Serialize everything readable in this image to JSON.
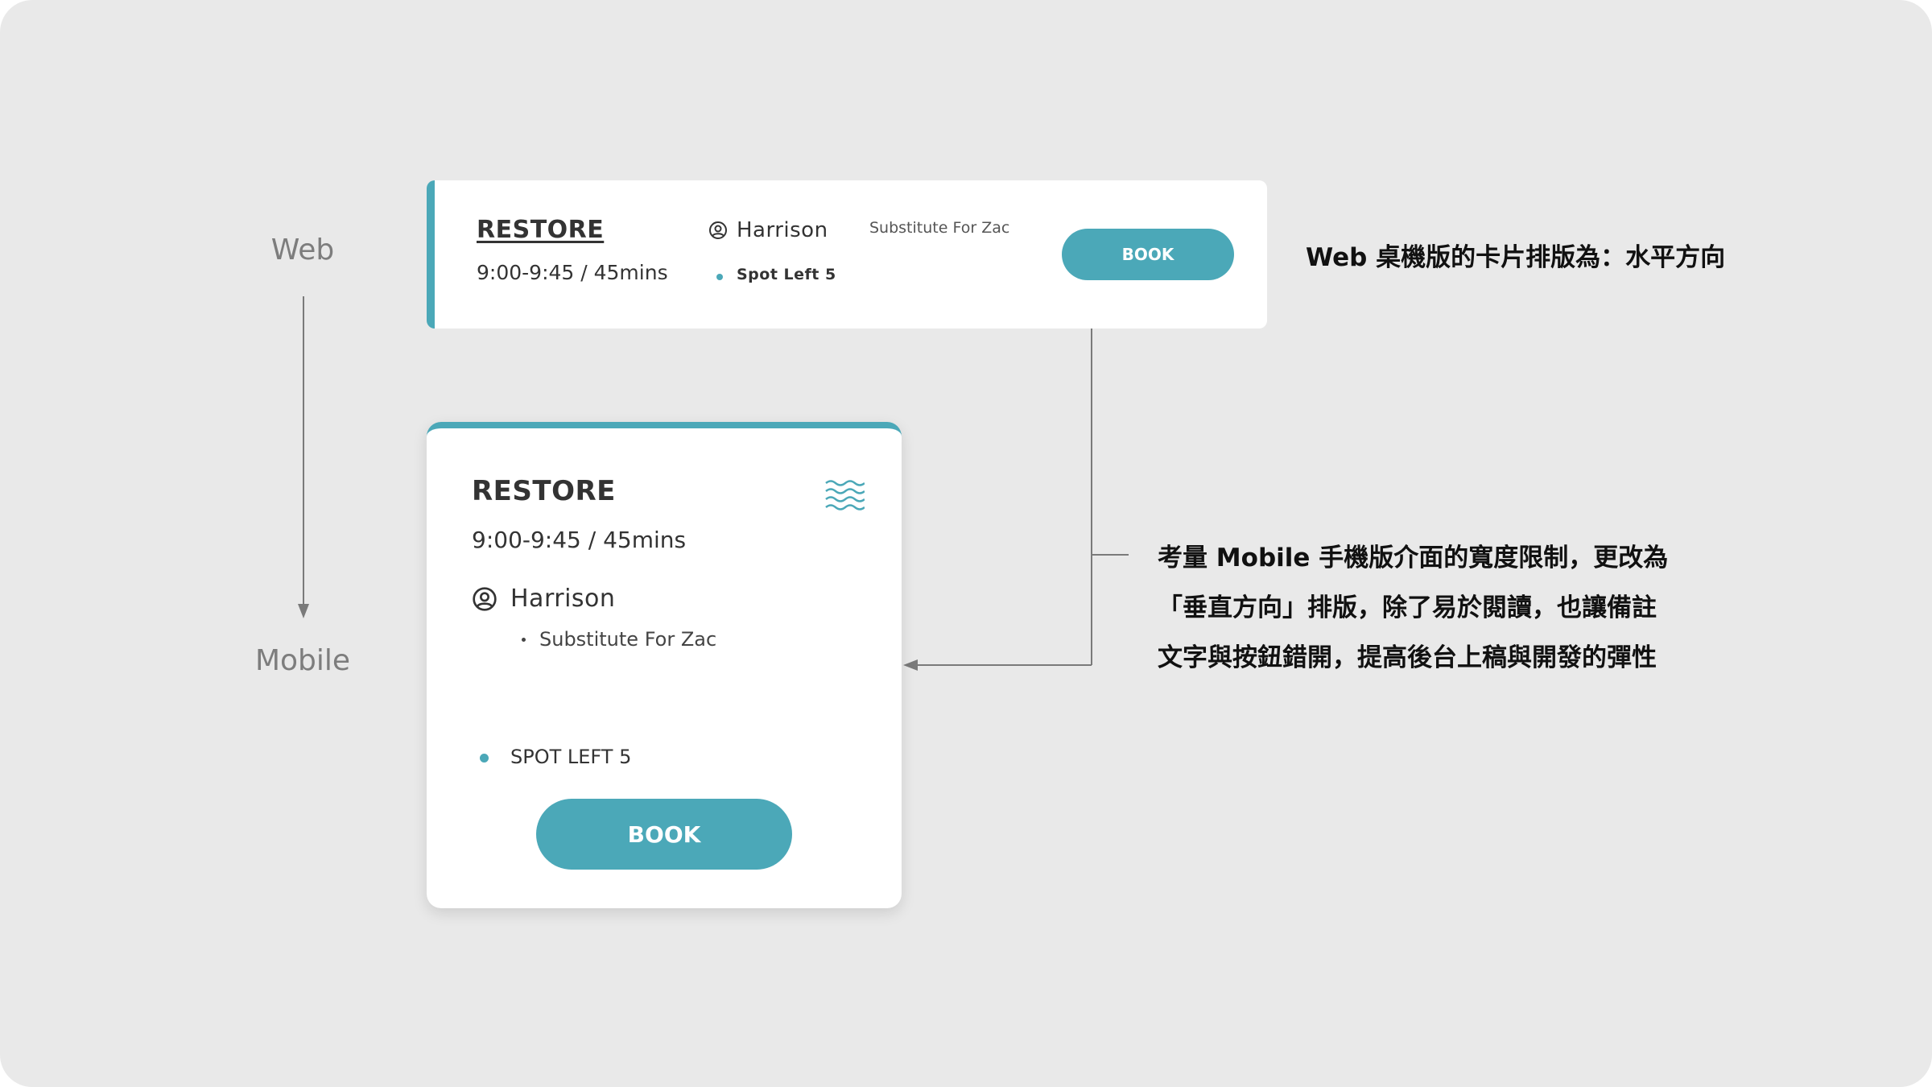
{
  "labels": {
    "web": "Web",
    "mobile": "Mobile"
  },
  "web_card": {
    "title": "RESTORE",
    "time": "9:00-9:45 / 45mins",
    "instructor": "Harrison",
    "spots": "Spot Left 5",
    "note": "Substitute For Zac",
    "book_label": "BOOK",
    "user_icon": "user-circle-icon"
  },
  "mobile_card": {
    "title": "RESTORE",
    "time": "9:00-9:45 / 45mins",
    "instructor": "Harrison",
    "note": "Substitute For Zac",
    "spots": "SPOT LEFT 5",
    "book_label": "BOOK",
    "user_icon": "user-circle-icon",
    "class_icon": "waves-icon"
  },
  "annotations": {
    "web": "Web 桌機版的卡片排版為：水平方向",
    "mobile_lines": [
      "考量 Mobile 手機版介面的寬度限制，更改為",
      "「垂直方向」排版，除了易於閱讀，也讓備註",
      "文字與按鈕錯開，提高後台上稿與開發的彈性"
    ]
  },
  "colors": {
    "accent": "#4ba8b8",
    "background": "#e9e9e9",
    "card": "#ffffff",
    "text": "#333333",
    "connector": "#7a7a7a"
  }
}
